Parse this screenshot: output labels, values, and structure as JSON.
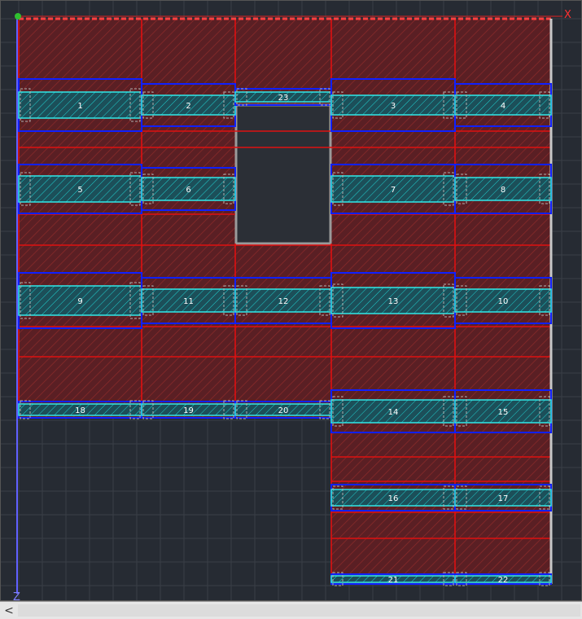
{
  "axes": {
    "x_label": "X",
    "z_label": "Z"
  },
  "colors": {
    "background": "#262b33",
    "grid": "#3a3f47",
    "slab": "#5a1f24",
    "slab_line": "#e01010",
    "beam_outline": "#1020ff",
    "beam_fill": "#20e0e0",
    "opening": "#2b2f36"
  },
  "beams": [
    {
      "id": "1",
      "label": "1"
    },
    {
      "id": "2",
      "label": "2"
    },
    {
      "id": "23",
      "label": "23"
    },
    {
      "id": "3",
      "label": "3"
    },
    {
      "id": "4",
      "label": "4"
    },
    {
      "id": "5",
      "label": "5"
    },
    {
      "id": "6",
      "label": "6"
    },
    {
      "id": "7",
      "label": "7"
    },
    {
      "id": "8",
      "label": "8"
    },
    {
      "id": "9",
      "label": "9"
    },
    {
      "id": "11",
      "label": "11"
    },
    {
      "id": "12",
      "label": "12"
    },
    {
      "id": "13",
      "label": "13"
    },
    {
      "id": "10",
      "label": "10"
    },
    {
      "id": "18",
      "label": "18"
    },
    {
      "id": "19",
      "label": "19"
    },
    {
      "id": "20",
      "label": "20"
    },
    {
      "id": "14",
      "label": "14"
    },
    {
      "id": "15",
      "label": "15"
    },
    {
      "id": "16",
      "label": "16"
    },
    {
      "id": "17",
      "label": "17"
    },
    {
      "id": "21",
      "label": "21"
    },
    {
      "id": "22",
      "label": "22"
    }
  ],
  "scrollbar": {
    "left_arrow": "<"
  }
}
